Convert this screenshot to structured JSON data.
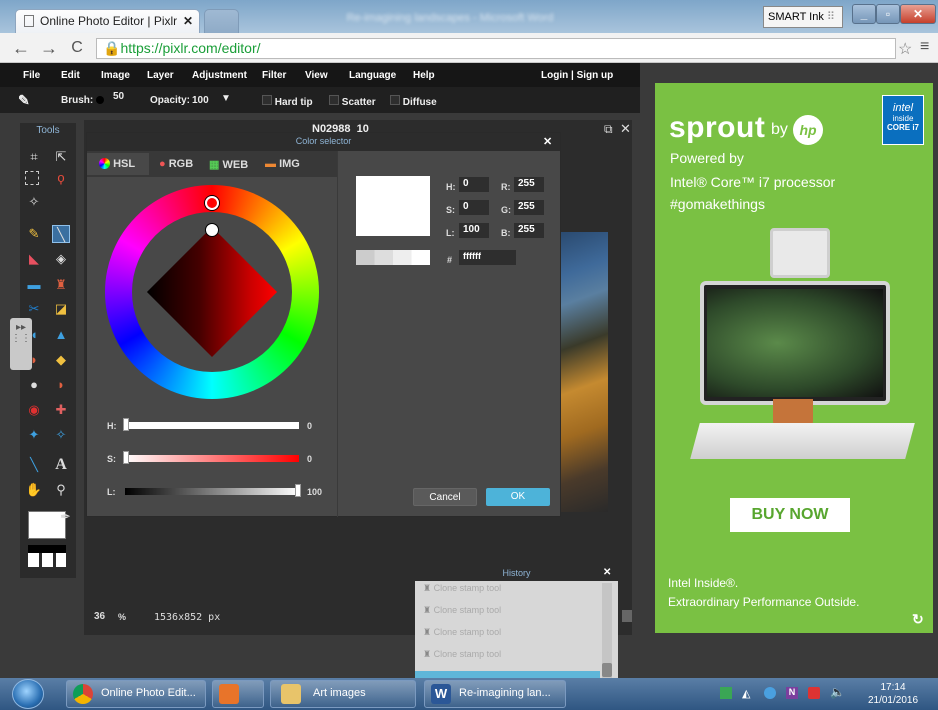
{
  "browser": {
    "tab_title": "Online Photo Editor | Pixlr",
    "tab2_title": "Re-imagining landscapes - Microsoft Word",
    "smart_ink_label": "SMART Ink",
    "url": "https://pixlr.com/editor/"
  },
  "menu": {
    "file": "File",
    "edit": "Edit",
    "image": "Image",
    "layer": "Layer",
    "adjustment": "Adjustment",
    "filter": "Filter",
    "view": "View",
    "language": "Language",
    "help": "Help",
    "login": "Login | Sign up"
  },
  "tool_options": {
    "brush_label": "Brush:",
    "brush_size": "50",
    "opacity_label": "Opacity:",
    "opacity_value": "100",
    "hard_tip": "Hard tip",
    "scatter": "Scatter",
    "diffuse": "Diffuse"
  },
  "tools": {
    "title": "Tools"
  },
  "image_window": {
    "title": "N02988_10",
    "zoom": "36",
    "zoom_unit": "%",
    "size": "1536x852 px"
  },
  "color_selector": {
    "title": "Color selector",
    "tabs": [
      "HSL",
      "RGB",
      "WEB",
      "IMG"
    ],
    "h_label": "H:",
    "h_value": "0",
    "s_label": "S:",
    "s_value": "0",
    "l_label": "L:",
    "l_value": "100",
    "r_label": "R:",
    "r_value": "255",
    "g_label": "G:",
    "g_value": "255",
    "b_label": "B:",
    "b_value": "255",
    "hex_label": "#",
    "hex_value": "ffffff",
    "slider_h_label": "H:",
    "slider_h_value": "0",
    "slider_s_label": "S:",
    "slider_s_value": "0",
    "slider_l_label": "L:",
    "slider_l_value": "100",
    "cancel": "Cancel",
    "ok": "OK",
    "current_color": "#ffffff"
  },
  "history": {
    "title": "History",
    "items": [
      "Clone stamp tool",
      "Clone stamp tool",
      "Clone stamp tool",
      "Clone stamp tool"
    ]
  },
  "ad": {
    "brand": "sprout",
    "by": "by",
    "powered": "Powered by",
    "processor": "Intel® Core™ i7 processor",
    "hashtag": "#gomakethings",
    "intel_badge_1": "intel",
    "intel_badge_2": "inside",
    "intel_badge_3": "CORE i7",
    "cta": "BUY NOW",
    "footer1": "Intel Inside®.",
    "footer2": "Extraordinary Performance Outside.",
    "bg_color": "#7ac143"
  },
  "taskbar": {
    "items": [
      "Online Photo Edit...",
      "",
      "Art images",
      "Re-imagining lan..."
    ],
    "time": "17:14",
    "date": "21/01/2016"
  }
}
